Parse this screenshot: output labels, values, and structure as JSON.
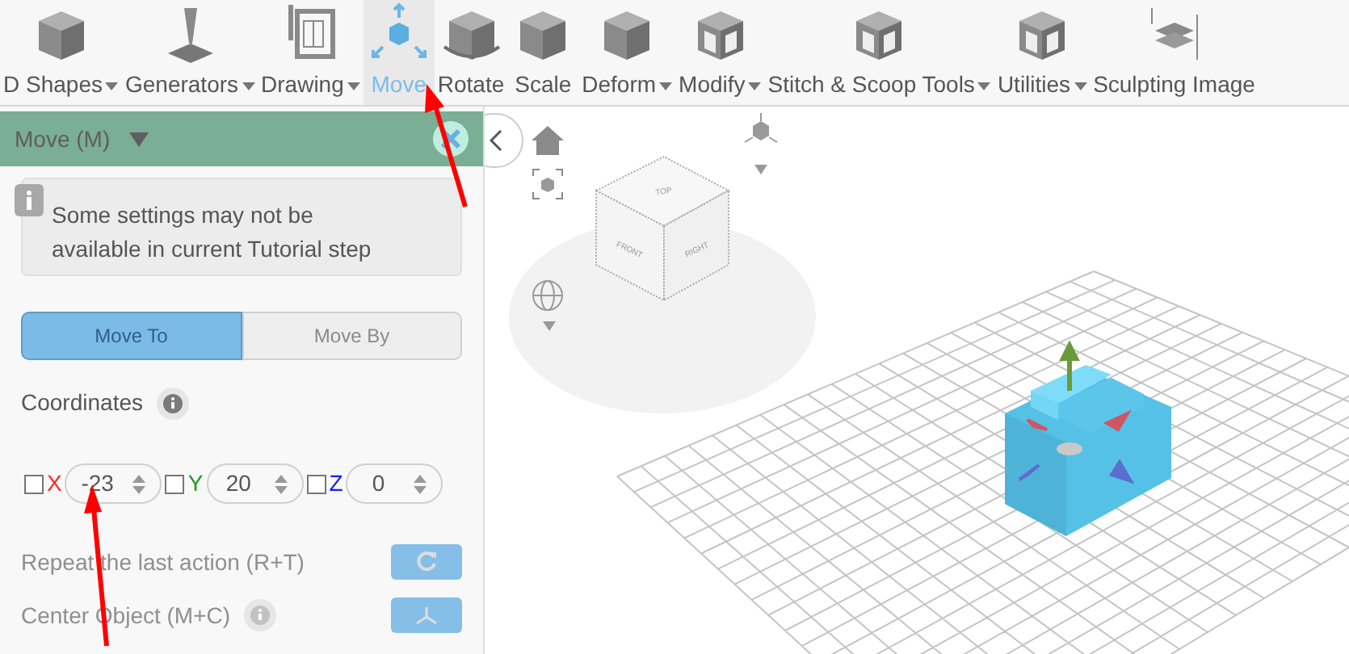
{
  "toolbar": {
    "items": [
      {
        "label": "D Shapes",
        "dropdown": true,
        "selected": false
      },
      {
        "label": "Generators",
        "dropdown": true,
        "selected": false
      },
      {
        "label": "Drawing",
        "dropdown": true,
        "selected": false
      },
      {
        "label": "Move",
        "dropdown": false,
        "selected": true
      },
      {
        "label": "Rotate",
        "dropdown": false,
        "selected": false
      },
      {
        "label": "Scale",
        "dropdown": false,
        "selected": false
      },
      {
        "label": "Deform",
        "dropdown": true,
        "selected": false
      },
      {
        "label": "Modify",
        "dropdown": true,
        "selected": false
      },
      {
        "label": "Stitch & Scoop Tools",
        "dropdown": true,
        "selected": false
      },
      {
        "label": "Utilities",
        "dropdown": true,
        "selected": false
      },
      {
        "label": "Sculpting Image",
        "dropdown": false,
        "selected": false
      }
    ]
  },
  "panel": {
    "title": "Move (M)",
    "notice": "Some settings may not be available in current Tutorial step",
    "mode_toggle": [
      {
        "label": "Move To",
        "selected": true
      },
      {
        "label": "Move By",
        "selected": false
      }
    ],
    "coordinates_label": "Coordinates",
    "axes": [
      {
        "axis": "X",
        "value": "-23",
        "checked": false,
        "color": "#ff2a2a"
      },
      {
        "axis": "Y",
        "value": "20",
        "checked": false,
        "color": "#1e9a1e"
      },
      {
        "axis": "Z",
        "value": "0",
        "checked": false,
        "color": "#1a1aff"
      }
    ],
    "actions": [
      {
        "kind": "repeat",
        "label": "Repeat the last action (R+T)",
        "disabled": true
      },
      {
        "kind": "center",
        "label": "Center Object (M+C)",
        "disabled": true
      }
    ]
  },
  "viewport": {
    "view_cube": [
      "TOP",
      "FRONT",
      "RIGHT"
    ]
  }
}
